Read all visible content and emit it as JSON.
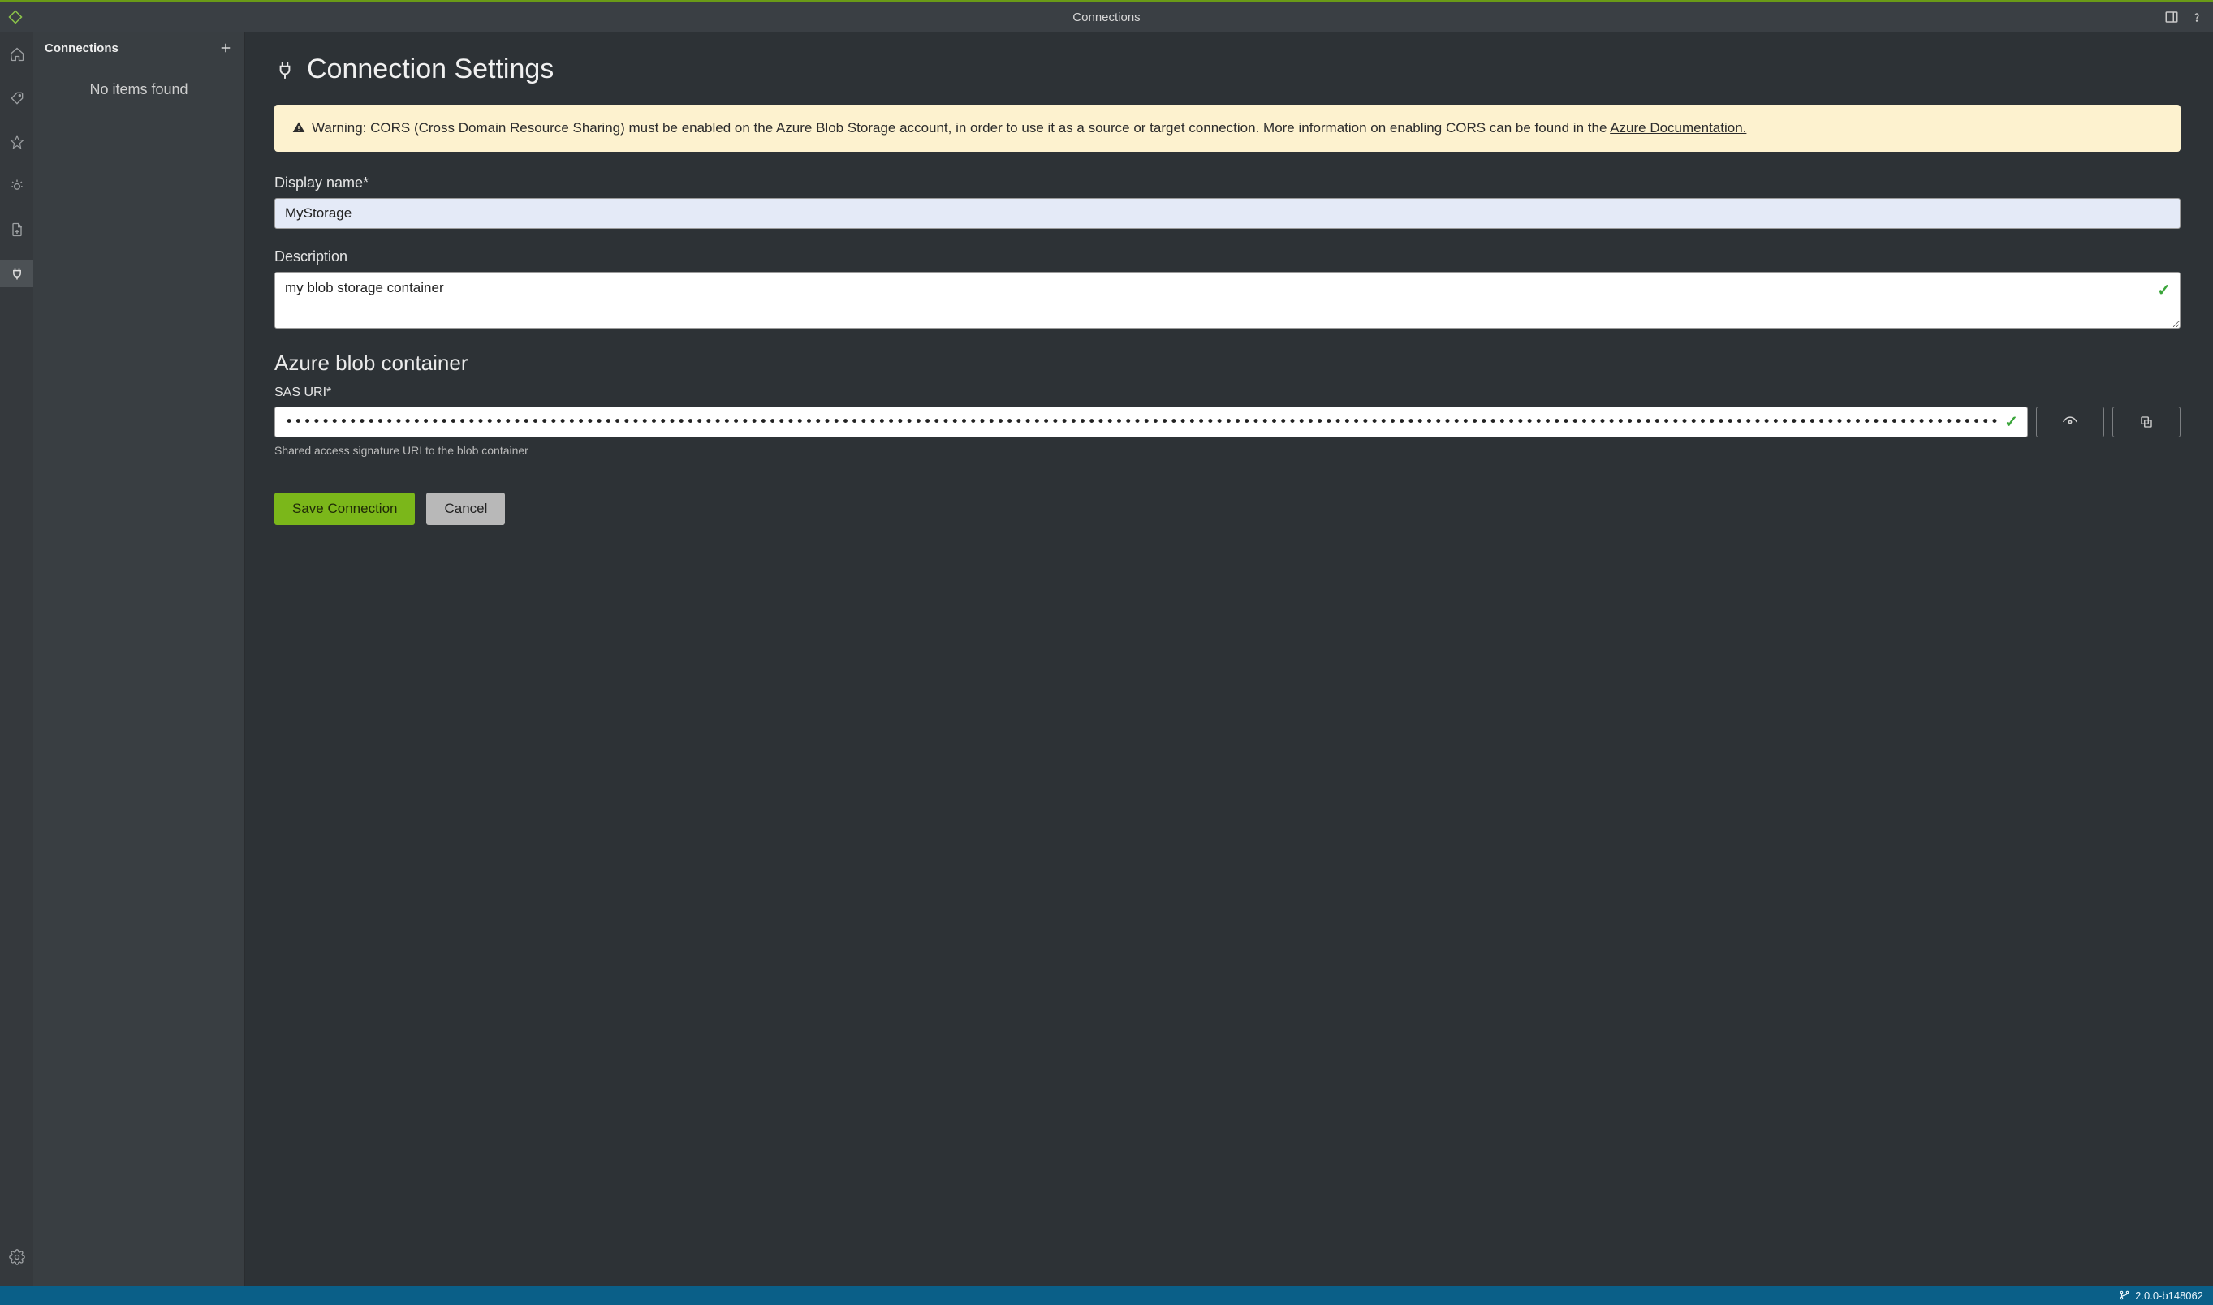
{
  "topbar": {
    "title": "Connections"
  },
  "sidepanel": {
    "title": "Connections",
    "empty": "No items found"
  },
  "page": {
    "heading": "Connection Settings",
    "warning_prefix": "Warning: CORS (Cross Domain Resource Sharing) must be enabled on the Azure Blob Storage account, in order to use it as a source or target connection. More information on enabling CORS can be found in the ",
    "warning_link": "Azure Documentation."
  },
  "form": {
    "display_name_label": "Display name*",
    "display_name_value": "MyStorage",
    "description_label": "Description",
    "description_value": "my blob storage container",
    "section_title": "Azure blob container",
    "sas_label": "SAS URI*",
    "sas_value": "••••••••••••••••••••••••••••••••••••••••••••••••••••••••••••••••••••••••••••••••••••••••••••••••••••••••••••••••••••••••••••••••••••••••••••••••••••••••••••••••••••••••••••••••••••••••••••••••••••",
    "sas_hint": "Shared access signature URI to the blob container",
    "save_label": "Save Connection",
    "cancel_label": "Cancel"
  },
  "status": {
    "version": "2.0.0-b148062"
  }
}
